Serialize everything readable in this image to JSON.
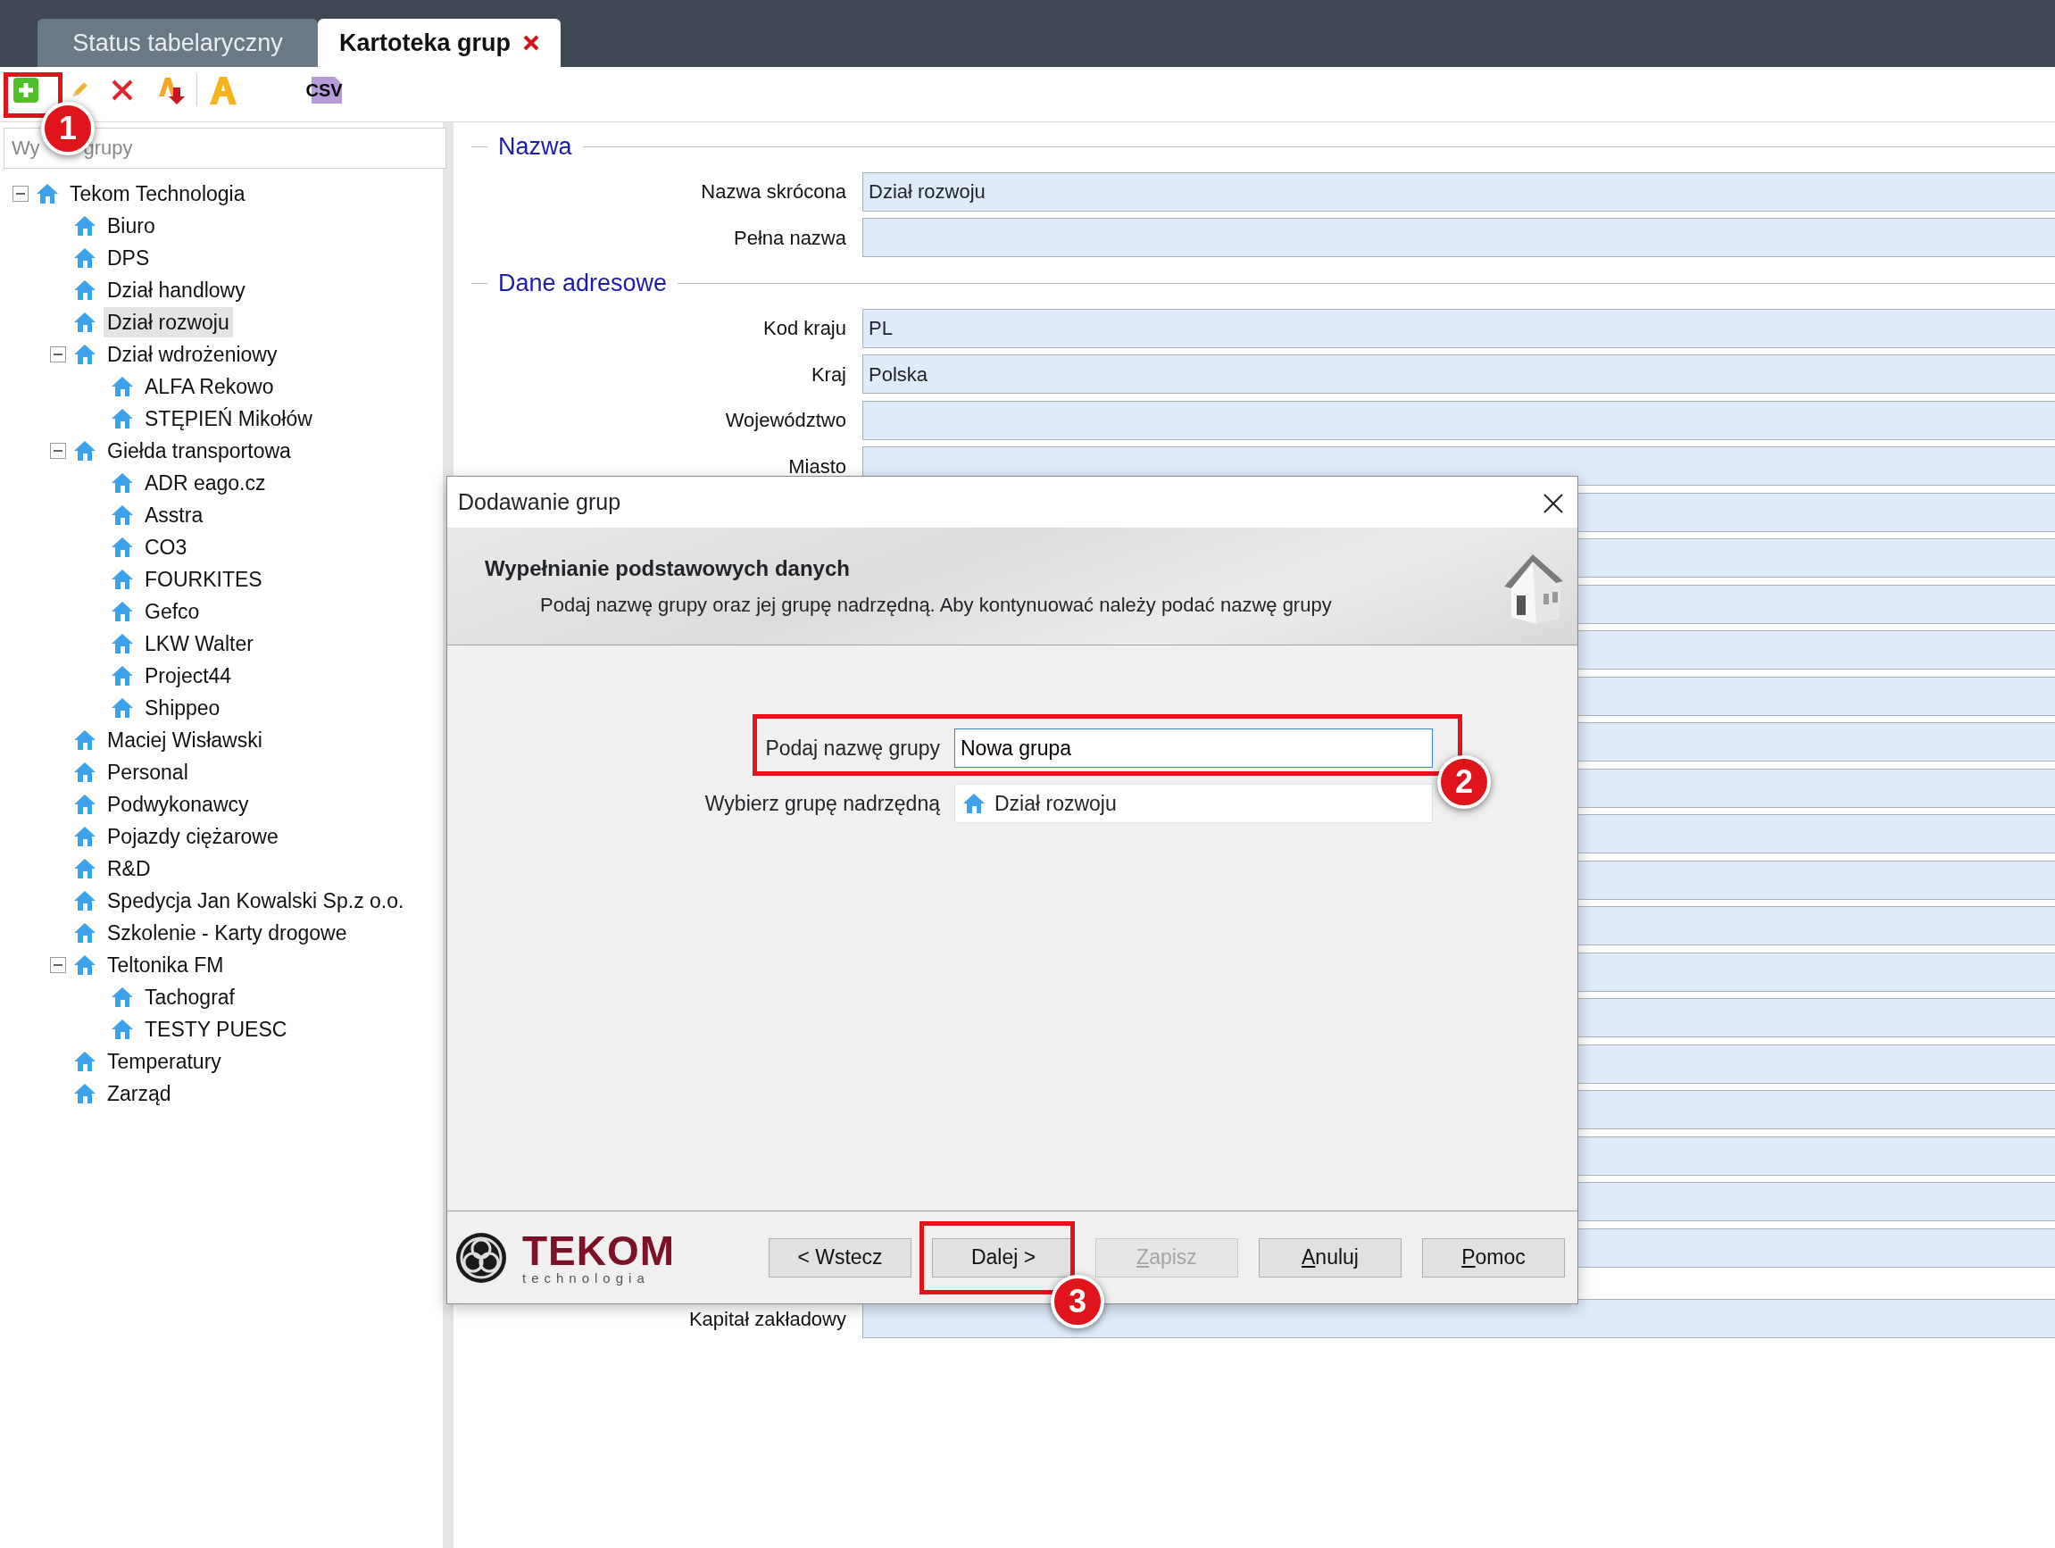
{
  "tabs": [
    {
      "label": "Status tabelaryczny",
      "selected": false,
      "closable": false
    },
    {
      "label": "Kartoteka grup",
      "selected": true,
      "closable": true
    }
  ],
  "toolbar": [
    {
      "kind": "add"
    },
    {
      "kind": "edit"
    },
    {
      "kind": "delete"
    },
    {
      "kind": "sort"
    },
    {
      "kind": "separator"
    },
    {
      "kind": "font"
    },
    {
      "kind": "csv",
      "text": "CSV"
    }
  ],
  "search": {
    "placeholder": "Wy        grupy"
  },
  "tree": [
    {
      "label": "Tekom Technologia",
      "selected": false,
      "expanded": true,
      "children": [
        {
          "label": "Biuro",
          "selected": false
        },
        {
          "label": "DPS",
          "selected": false
        },
        {
          "label": "Dział handlowy",
          "selected": false
        },
        {
          "label": "Dział rozwoju",
          "selected": true
        },
        {
          "label": "Dział wdrożeniowy",
          "selected": false,
          "expanded": true,
          "children": [
            {
              "label": "ALFA Rekowo",
              "selected": false
            },
            {
              "label": "STĘPIEŃ Mikołów",
              "selected": false
            }
          ]
        },
        {
          "label": "Giełda transportowa",
          "selected": false,
          "expanded": true,
          "children": [
            {
              "label": "ADR eago.cz",
              "selected": false
            },
            {
              "label": "Asstra",
              "selected": false
            },
            {
              "label": "CO3",
              "selected": false
            },
            {
              "label": "FOURKITES",
              "selected": false
            },
            {
              "label": "Gefco",
              "selected": false
            },
            {
              "label": "LKW Walter",
              "selected": false
            },
            {
              "label": "Project44",
              "selected": false
            },
            {
              "label": "Shippeo",
              "selected": false
            }
          ]
        },
        {
          "label": "Maciej Wisławski",
          "selected": false
        },
        {
          "label": "Personal",
          "selected": false
        },
        {
          "label": "Podwykonawcy",
          "selected": false
        },
        {
          "label": "Pojazdy ciężarowe",
          "selected": false
        },
        {
          "label": "R&D",
          "selected": false
        },
        {
          "label": "Spedycja Jan Kowalski Sp.z o.o.",
          "selected": false
        },
        {
          "label": "Szkolenie - Karty drogowe",
          "selected": false
        },
        {
          "label": "Teltonika FM",
          "selected": false,
          "expanded": true,
          "children": [
            {
              "label": "Tachograf",
              "selected": false
            },
            {
              "label": "TESTY PUESC",
              "selected": false
            }
          ]
        },
        {
          "label": "Temperatury",
          "selected": false
        },
        {
          "label": "Zarząd",
          "selected": false
        }
      ]
    }
  ],
  "form": [
    {
      "title": "Nazwa",
      "rows": [
        {
          "kind": "field",
          "label": "Nazwa skrócona",
          "value": "Dział rozwoju"
        },
        {
          "kind": "field",
          "label": "Pełna nazwa"
        }
      ]
    },
    {
      "title": "Dane adresowe",
      "rows": [
        {
          "kind": "field",
          "label": "Kod kraju",
          "value": "PL"
        },
        {
          "kind": "field",
          "label": "Kraj",
          "value": "Polska"
        },
        {
          "kind": "field",
          "label": "Województwo"
        },
        {
          "kind": "field",
          "label": "Miasto"
        },
        {
          "kind": "field"
        },
        {
          "kind": "field"
        },
        {
          "kind": "field"
        },
        {
          "kind": "field"
        },
        {
          "kind": "field"
        },
        {
          "kind": "field"
        },
        {
          "kind": "field"
        },
        {
          "kind": "field"
        },
        {
          "kind": "field"
        },
        {
          "kind": "field"
        },
        {
          "kind": "field"
        },
        {
          "kind": "field"
        },
        {
          "kind": "field"
        },
        {
          "kind": "field"
        },
        {
          "kind": "field"
        },
        {
          "kind": "field"
        },
        {
          "kind": "field"
        },
        {
          "kind": "field",
          "label": "Kapitał zakładowy"
        }
      ]
    }
  ],
  "dialog": {
    "title": "Dodawanie grup",
    "heading": "Wypełnianie podstawowych danych",
    "description": "Podaj nazwę grupy oraz jej grupę nadrzędną. Aby kontynuować należy podać nazwę grupy",
    "fields": [
      {
        "kind": "text",
        "label": "Podaj nazwę grupy",
        "value": "Nowa grupa"
      },
      {
        "kind": "combo",
        "label": "Wybierz grupę nadrzędną",
        "value": "Dział rozwoju"
      }
    ],
    "logo": {
      "name": "TEKOM",
      "tagline": "technologia"
    },
    "buttons": [
      {
        "label": "< Wstecz",
        "disabled": false,
        "mnemonic": false
      },
      {
        "label": "Dalej >",
        "disabled": false,
        "mnemonic": false
      },
      {
        "label": "Zapisz",
        "disabled": true,
        "mnemonic": true
      },
      {
        "label": "Anuluj",
        "disabled": false,
        "mnemonic": true
      },
      {
        "label": "Pomoc",
        "disabled": false,
        "mnemonic": true
      }
    ]
  },
  "annotations": [
    {
      "number": "1"
    },
    {
      "number": "2"
    },
    {
      "number": "3"
    }
  ]
}
